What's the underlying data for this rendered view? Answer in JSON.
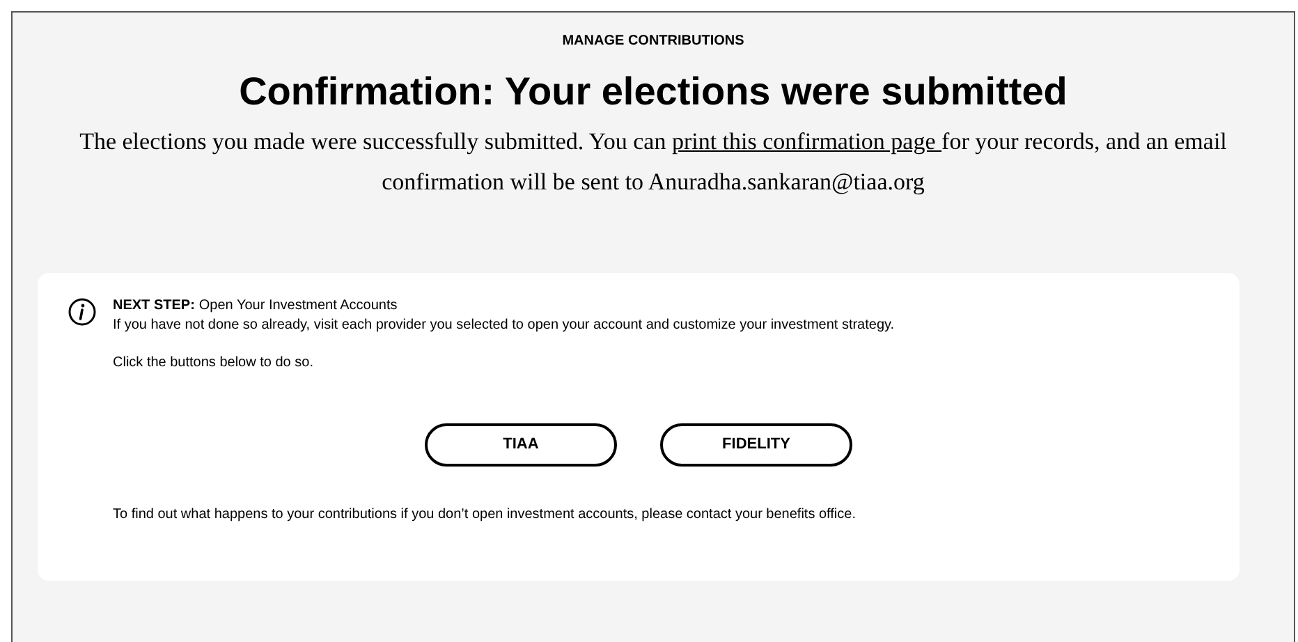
{
  "section_label": "MANAGE CONTRIBUTIONS",
  "title": "Confirmation: Your elections were submitted",
  "description": {
    "before": "The elections you made were successfully submitted. You can ",
    "link": "print this confirmation page ",
    "after": "for your records, and an email confirmation will be sent to Anuradha.sankaran@tiaa.org"
  },
  "next_step": {
    "label": "NEXT STEP:",
    "heading": "Open Your Investment Accounts",
    "text": "If you have not done so already, visit each provider you selected to open your account and customize your investment strategy.",
    "instruction": "Click the buttons below to do so.",
    "buttons": [
      "TIAA",
      "FIDELITY"
    ],
    "footnote": "To find out what happens to your contributions if you don’t open investment accounts, please contact your benefits office."
  }
}
